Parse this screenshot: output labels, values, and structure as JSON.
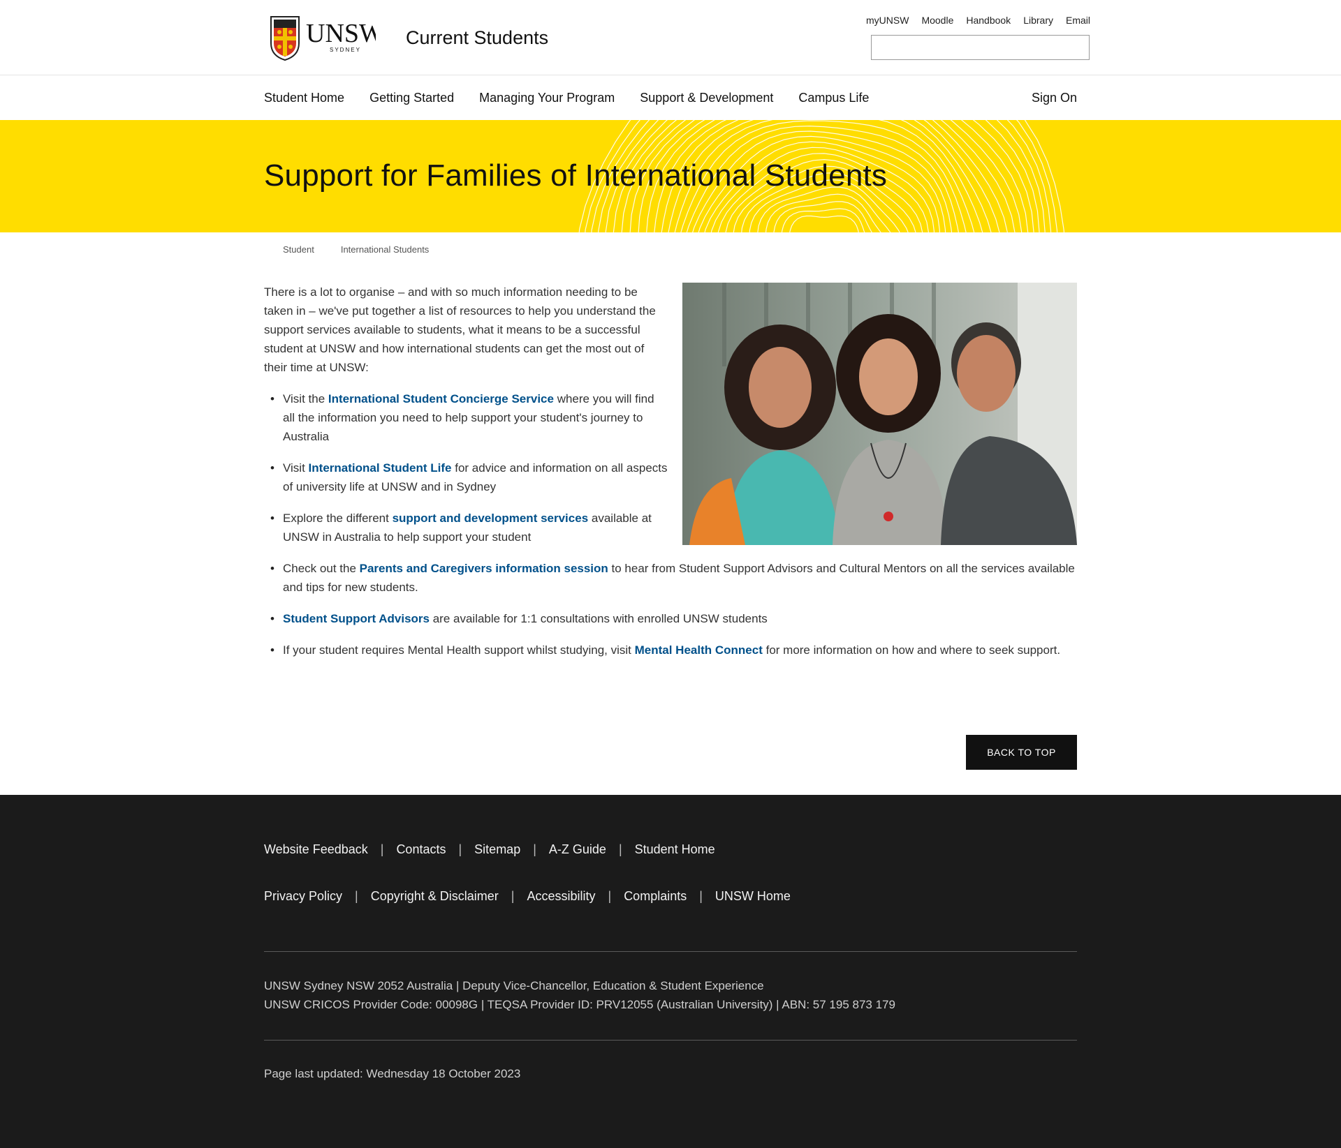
{
  "header": {
    "logo_text": "UNSW",
    "logo_subtext": "SYDNEY",
    "site_title": "Current Students",
    "utility_links": [
      "myUNSW",
      "Moodle",
      "Handbook",
      "Library",
      "Email"
    ],
    "search_placeholder": ""
  },
  "nav": {
    "items": [
      "Student Home",
      "Getting Started",
      "Managing Your Program",
      "Support & Development",
      "Campus Life"
    ],
    "sign_on": "Sign On"
  },
  "banner": {
    "title": "Support for Families of International Students",
    "color": "#ffdd00"
  },
  "breadcrumb": [
    "Student",
    "International Students"
  ],
  "content": {
    "intro": "There is a lot to organise – and with so much information needing to be taken in – we've put together a list of resources to help you understand the support services available to students, what it means to be a successful student at UNSW and how international students can get the most out of their time at UNSW:",
    "bullets": [
      {
        "before": "Visit the ",
        "link": "International Student Concierge Service",
        "after": " where you will find all the information you need to help support your student's journey to Australia"
      },
      {
        "before": "Visit ",
        "link": "International Student Life",
        "after": " for advice and information on all aspects of university life at UNSW and in Sydney"
      },
      {
        "before": "Explore the different ",
        "link": "support and development services",
        "after": " available at UNSW in Australia to help support your student"
      },
      {
        "before": "Check out the ",
        "link": "Parents and Caregivers information session",
        "after": " to hear from Student Support Advisors and Cultural Mentors on all the services available and tips for new students."
      },
      {
        "before": "",
        "link": "Student Support Advisors",
        "after": " are available for 1:1 consultations with enrolled UNSW students"
      },
      {
        "before": "If your student requires Mental Health support whilst studying, visit ",
        "link": "Mental Health Connect",
        "after": " for more information on how and where to seek support."
      }
    ],
    "link_color": "#00508a"
  },
  "back_to_top": "BACK TO TOP",
  "footer": {
    "row1": [
      "Website Feedback",
      "Contacts",
      "Sitemap",
      "A-Z Guide",
      "Student Home"
    ],
    "row2": [
      "Privacy Policy",
      "Copyright & Disclaimer",
      "Accessibility",
      "Complaints",
      "UNSW Home"
    ],
    "separator": "|",
    "address_line1": "UNSW Sydney NSW 2052 Australia | Deputy Vice-Chancellor, Education & Student Experience",
    "address_line2": "UNSW CRICOS Provider Code: 00098G | TEQSA Provider ID: PRV12055 (Australian University) | ABN: 57 195 873 179",
    "updated": "Page last updated: Wednesday 18 October 2023"
  }
}
